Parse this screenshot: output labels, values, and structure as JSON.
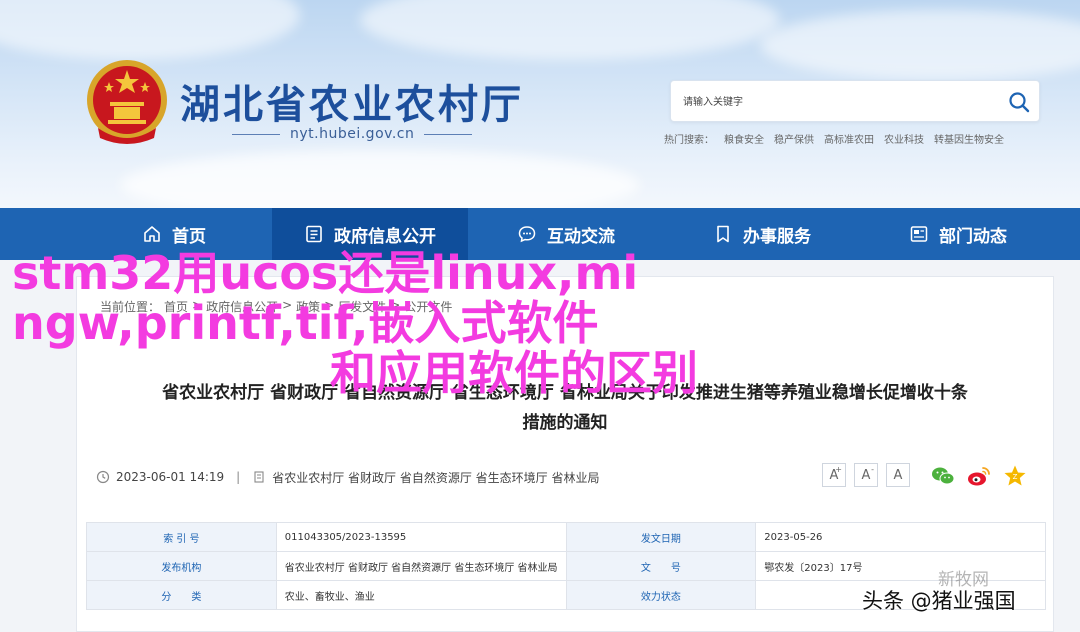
{
  "header": {
    "site_title": "湖北省农业农村厅",
    "site_url": "nyt.hubei.gov.cn",
    "search_placeholder": "请输入关键字",
    "hot_label": "热门搜索：",
    "hot_items": [
      "粮食安全",
      "稳产保供",
      "高标准农田",
      "农业科技",
      "转基因生物安全"
    ]
  },
  "nav": {
    "items": [
      {
        "label": "首页",
        "icon": "home-icon"
      },
      {
        "label": "政府信息公开",
        "icon": "document-list-icon"
      },
      {
        "label": "互动交流",
        "icon": "chat-bubble-icon"
      },
      {
        "label": "办事服务",
        "icon": "bookmark-icon"
      },
      {
        "label": "部门动态",
        "icon": "news-icon"
      }
    ],
    "active_index": 1
  },
  "breadcrumb": {
    "label": "当前位置：",
    "items": [
      "首页",
      "政府信息公开",
      "政策",
      "厅发文件",
      "公开文件"
    ],
    "separator": ">"
  },
  "article": {
    "title_line1": "省农业农村厅 省财政厅 省自然资源厅 省生态环境厅 省林业局关于印发推进生猪等养殖业稳增长促增收十条",
    "title_line2": "措施的通知",
    "date": "2023-06-01 14:19",
    "separator": "|",
    "orgs": "省农业农村厅 省财政厅 省自然资源厅 省生态环境厅 省林业局",
    "font_buttons": [
      "A",
      "A",
      "A"
    ]
  },
  "meta_table": {
    "rows": [
      {
        "k1": "索 引 号",
        "v1": "011043305/2023-13595",
        "k2": "发文日期",
        "v2": "2023-05-26"
      },
      {
        "k1": "发布机构",
        "v1": "省农业农村厅 省财政厅 省自然资源厅 省生态环境厅 省林业局",
        "k2": "文　　号",
        "v2": "鄂农发〔2023〕17号"
      },
      {
        "k1": "分　　类",
        "v1": "农业、畜牧业、渔业",
        "k2": "效力状态",
        "v2": ""
      }
    ]
  },
  "overlay": {
    "line1": "stm32用ucos还是linux,mi",
    "line2": "ngw,printf,tif,嵌入式软件",
    "line3": "和应用软件的区别",
    "source": "头条 @猪业强国",
    "faint": "新牧网"
  },
  "colors": {
    "nav_bg": "#1e64b3",
    "nav_active": "#0f4e9b",
    "title_blue": "#1d4f9c",
    "overlay_pink": "#f33be0"
  }
}
